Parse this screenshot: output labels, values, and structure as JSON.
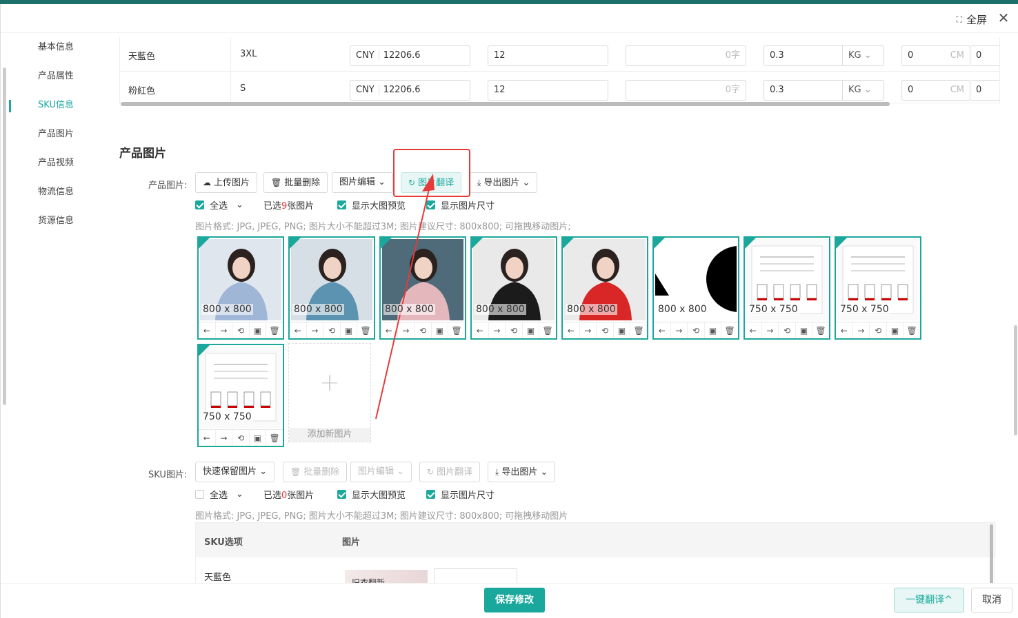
{
  "header": {
    "fullscreen_label": "全屏",
    "close_symbol": "✕"
  },
  "sidenav": {
    "items": [
      {
        "label": "基本信息"
      },
      {
        "label": "产品属性"
      },
      {
        "label": "SKU信息"
      },
      {
        "label": "产品图片"
      },
      {
        "label": "产品视频"
      },
      {
        "label": "物流信息"
      },
      {
        "label": "货源信息"
      }
    ],
    "active": "SKU信息"
  },
  "sku_rows": [
    {
      "color": "天藍色",
      "size": "3XL",
      "currency": "CNY",
      "price": "12206.6",
      "stock": "12",
      "text_count": "0字",
      "weight": "0.3",
      "weight_unit": "KG",
      "dim": "0",
      "dim_unit": "CM",
      "dim2": "0"
    },
    {
      "color": "粉紅色",
      "size": "S",
      "currency": "CNY",
      "price": "12206.6",
      "stock": "12",
      "text_count": "0字",
      "weight": "0.3",
      "weight_unit": "KG",
      "dim": "0",
      "dim_unit": "CM",
      "dim2": "0"
    }
  ],
  "product_images": {
    "section_title": "产品图片",
    "label": "产品图片:",
    "buttons": {
      "upload": "上传图片",
      "batch_delete": "批量删除",
      "edit": "图片编辑",
      "translate": "图片翻译",
      "export": "导出图片"
    },
    "select_all": "全选",
    "selected_prefix": "已选",
    "selected_count": "9",
    "selected_suffix": "张图片",
    "show_preview": "显示大图预览",
    "show_size": "显示图片尺寸",
    "hint": "图片格式: JPG, JPEG, PNG; 图片大小不能超过3M; 图片建议尺寸: 800x800; 可拖拽移动图片;",
    "thumbs": [
      {
        "size": "800 x 800",
        "shirt": "#9fb6d6",
        "bg": "#dfe6ee"
      },
      {
        "size": "800 x 800",
        "shirt": "#5c93b0",
        "bg": "#d6dfe6"
      },
      {
        "size": "800 x 800",
        "shirt": "#e4b7bd",
        "bg": "#4f6a78"
      },
      {
        "size": "800 x 800",
        "shirt": "#1b1b1b",
        "bg": "#e9e9e9"
      },
      {
        "size": "800 x 800",
        "shirt": "#d92626",
        "bg": "#eaeaea"
      },
      {
        "size": "800 x 800",
        "shirt": "",
        "bg": "#ffffff"
      },
      {
        "size": "750 x 750",
        "shirt": "",
        "bg": "#ffffff"
      },
      {
        "size": "750 x 750",
        "shirt": "",
        "bg": "#ffffff"
      },
      {
        "size": "750 x 750",
        "shirt": "",
        "bg": "#ffffff"
      }
    ],
    "add_new": "添加新图片"
  },
  "sku_images": {
    "label": "SKU图片:",
    "buttons": {
      "quick_keep": "快速保留图片",
      "batch_delete": "批量删除",
      "edit": "图片编辑",
      "translate": "图片翻译",
      "export": "导出图片"
    },
    "select_all": "全选",
    "selected_prefix": "已选",
    "selected_count": "0",
    "selected_suffix": "张图片",
    "show_preview": "显示大图预览",
    "show_size": "显示图片尺寸",
    "hint": "图片格式: JPG, JPEG, PNG; 图片大小不能超过3M; 图片建议尺寸: 800x800; 可拖拽移动图片",
    "table": {
      "col_option": "SKU选项",
      "col_image": "图片",
      "rows": [
        {
          "option": "天藍色",
          "thumb_text": "旧衣翻新"
        }
      ]
    }
  },
  "footer": {
    "save": "保存修改",
    "translate_all": "一键翻译^",
    "cancel": "取消"
  },
  "colors": {
    "accent": "#1aa89c",
    "highlight_box": "#e53b3b"
  }
}
